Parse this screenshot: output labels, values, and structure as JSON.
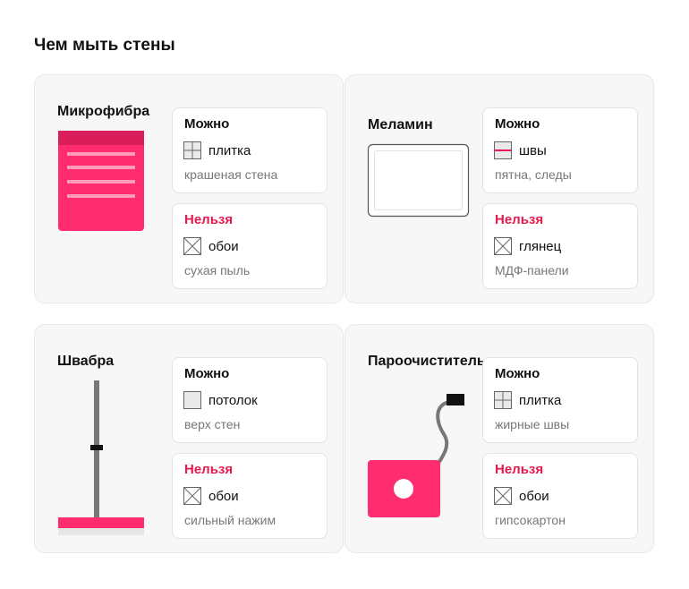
{
  "page": {
    "title": "Чем мыть стены"
  },
  "colors": {
    "accent": "#ff2d6f",
    "forbidden": "#e8174d",
    "card_bg": "#f7f7f7"
  },
  "cards": [
    {
      "title": "Микрофибра",
      "illustration": "microfiber-cloth",
      "allowed": {
        "heading": "Можно",
        "icon": "tile-icon",
        "item": "плитка",
        "note": "крашеная стена"
      },
      "forbidden": {
        "heading": "Нельзя",
        "icon": "cross-icon",
        "item": "обои",
        "note": "сухая пыль"
      }
    },
    {
      "title": "Меламин",
      "illustration": "melamine-sponge",
      "allowed": {
        "heading": "Можно",
        "icon": "seam-icon",
        "item": "швы",
        "note": "пятна, следы"
      },
      "forbidden": {
        "heading": "Нельзя",
        "icon": "cross-icon",
        "item": "глянец",
        "note": "МДФ-панели"
      }
    },
    {
      "title": "Швабра",
      "illustration": "mop",
      "allowed": {
        "heading": "Можно",
        "icon": "ceiling-icon",
        "item": "потолок",
        "note": "верх стен"
      },
      "forbidden": {
        "heading": "Нельзя",
        "icon": "cross-icon",
        "item": "обои",
        "note": "сильный нажим"
      }
    },
    {
      "title": "Пароочиститель",
      "illustration": "steam-cleaner",
      "allowed": {
        "heading": "Можно",
        "icon": "tile-icon",
        "item": "плитка",
        "note": "жирные швы"
      },
      "forbidden": {
        "heading": "Нельзя",
        "icon": "cross-icon",
        "item": "обои",
        "note": "гипсокартон"
      }
    }
  ]
}
